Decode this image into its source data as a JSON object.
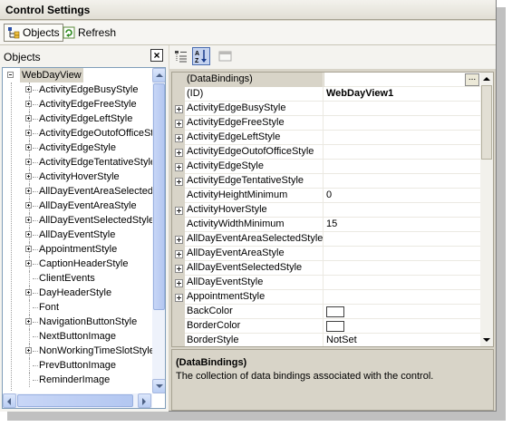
{
  "window": {
    "title": "Control Settings"
  },
  "toolbar": {
    "objects_label": "Objects",
    "refresh_label": "Refresh"
  },
  "left_panel": {
    "label": "Objects",
    "close_glyph": "×",
    "tree": {
      "root": "WebDayView",
      "items": [
        {
          "label": "ActivityEdgeBusyStyle",
          "expandable": true
        },
        {
          "label": "ActivityEdgeFreeStyle",
          "expandable": true
        },
        {
          "label": "ActivityEdgeLeftStyle",
          "expandable": true
        },
        {
          "label": "ActivityEdgeOutofOfficeSt",
          "expandable": true
        },
        {
          "label": "ActivityEdgeStyle",
          "expandable": true
        },
        {
          "label": "ActivityEdgeTentativeStyle",
          "expandable": true
        },
        {
          "label": "ActivityHoverStyle",
          "expandable": true
        },
        {
          "label": "AllDayEventAreaSelected",
          "expandable": true
        },
        {
          "label": "AllDayEventAreaStyle",
          "expandable": true
        },
        {
          "label": "AllDayEventSelectedStyle",
          "expandable": true
        },
        {
          "label": "AllDayEventStyle",
          "expandable": true
        },
        {
          "label": "AppointmentStyle",
          "expandable": true
        },
        {
          "label": "CaptionHeaderStyle",
          "expandable": true
        },
        {
          "label": "ClientEvents",
          "expandable": false
        },
        {
          "label": "DayHeaderStyle",
          "expandable": true
        },
        {
          "label": "Font",
          "expandable": false
        },
        {
          "label": "NavigationButtonStyle",
          "expandable": true
        },
        {
          "label": "NextButtonImage",
          "expandable": false
        },
        {
          "label": "NonWorkingTimeSlotStyle",
          "expandable": true
        },
        {
          "label": "PrevButtonImage",
          "expandable": false
        },
        {
          "label": "ReminderImage",
          "expandable": false
        }
      ]
    }
  },
  "property_grid": {
    "rows": [
      {
        "name": "(DataBindings)",
        "value": "",
        "expandable": false,
        "selected": true,
        "ellipsis": "..."
      },
      {
        "name": "(ID)",
        "value": "WebDayView1",
        "expandable": false,
        "bold_value": true
      },
      {
        "name": "ActivityEdgeBusyStyle",
        "value": "",
        "expandable": true
      },
      {
        "name": "ActivityEdgeFreeStyle",
        "value": "",
        "expandable": true
      },
      {
        "name": "ActivityEdgeLeftStyle",
        "value": "",
        "expandable": true
      },
      {
        "name": "ActivityEdgeOutofOfficeStyle",
        "value": "",
        "expandable": true
      },
      {
        "name": "ActivityEdgeStyle",
        "value": "",
        "expandable": true
      },
      {
        "name": "ActivityEdgeTentativeStyle",
        "value": "",
        "expandable": true
      },
      {
        "name": "ActivityHeightMinimum",
        "value": "0",
        "expandable": false
      },
      {
        "name": "ActivityHoverStyle",
        "value": "",
        "expandable": true
      },
      {
        "name": "ActivityWidthMinimum",
        "value": "15",
        "expandable": false
      },
      {
        "name": "AllDayEventAreaSelectedStyle",
        "value": "",
        "expandable": true
      },
      {
        "name": "AllDayEventAreaStyle",
        "value": "",
        "expandable": true
      },
      {
        "name": "AllDayEventSelectedStyle",
        "value": "",
        "expandable": true
      },
      {
        "name": "AllDayEventStyle",
        "value": "",
        "expandable": true
      },
      {
        "name": "AppointmentStyle",
        "value": "",
        "expandable": true
      },
      {
        "name": "BackColor",
        "value": "",
        "expandable": false,
        "swatch": "#ffffff"
      },
      {
        "name": "BorderColor",
        "value": "",
        "expandable": false,
        "swatch": "#ffffff"
      },
      {
        "name": "BorderStyle",
        "value": "NotSet",
        "expandable": false
      }
    ]
  },
  "description": {
    "title": "(DataBindings)",
    "text": "The collection of data bindings associated with the control."
  },
  "colors": {
    "panel_bg": "#d8d4c8",
    "tree_border": "#7f9db9",
    "selected_tool": "#c5d3ef"
  }
}
